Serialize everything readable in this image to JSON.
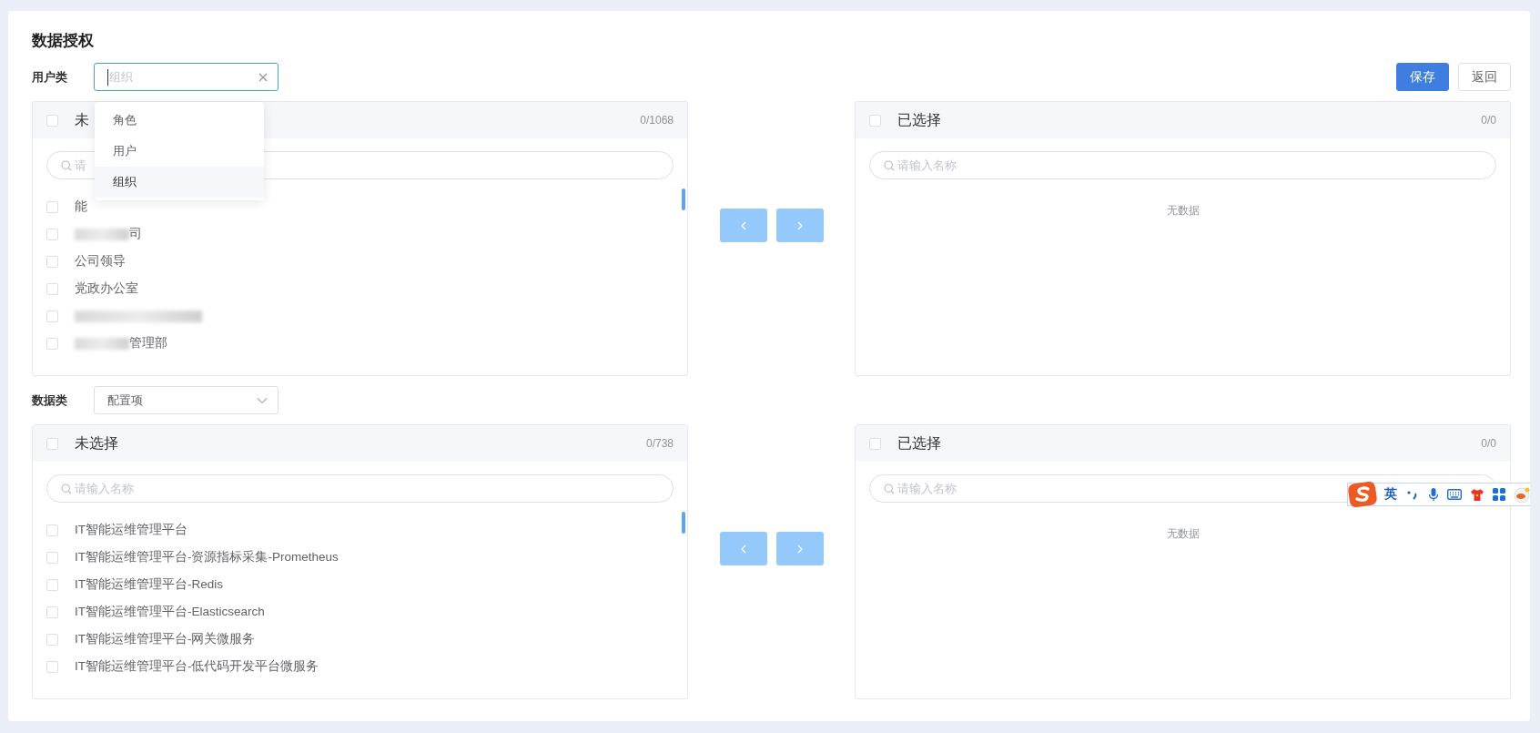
{
  "title": "数据授权",
  "actions": [
    {
      "label": "保存",
      "kind": "primary"
    },
    {
      "label": "返回",
      "kind": "default"
    }
  ],
  "sections": [
    {
      "label": "用户类",
      "select": {
        "placeholder": "组织",
        "focused": true,
        "clearable": true
      },
      "dropdown": {
        "options": [
          {
            "label": "角色",
            "selected": false
          },
          {
            "label": "用户",
            "selected": false
          },
          {
            "label": "组织",
            "selected": true
          }
        ]
      },
      "source": {
        "title": "未",
        "checked": false,
        "count": "0/1068",
        "search_placeholder": "请",
        "items": [
          {
            "label": "能",
            "checked": false,
            "blurred": false
          },
          {
            "label": "司",
            "checked": false,
            "blurred": true
          },
          {
            "label": "公司领导",
            "checked": false,
            "blurred": false
          },
          {
            "label": "党政办公室",
            "checked": false,
            "blurred": false
          },
          {
            "checked": false,
            "blurred": true
          },
          {
            "label": "管理部",
            "checked": false,
            "blurred": true
          }
        ]
      },
      "transfer_buttons": [
        {
          "disabled": true
        },
        {
          "disabled": true
        }
      ],
      "target": {
        "title": "已选择",
        "checked": false,
        "count": "0/0",
        "search_placeholder": "请输入名称",
        "empty_text": "无数据"
      }
    },
    {
      "label": "数据类",
      "select": {
        "value": "配置项",
        "focused": false,
        "clearable": false
      },
      "source": {
        "title": "未选择",
        "checked": false,
        "count": "0/738",
        "search_placeholder": "请输入名称",
        "items": [
          {
            "label": "IT智能运维管理平台",
            "checked": false,
            "blurred": false
          },
          {
            "label": "IT智能运维管理平台-资源指标采集-Prometheus",
            "checked": false,
            "blurred": false
          },
          {
            "label": "IT智能运维管理平台-Redis",
            "checked": false,
            "blurred": false
          },
          {
            "label": "IT智能运维管理平台-Elasticsearch",
            "checked": false,
            "blurred": false
          },
          {
            "label": "IT智能运维管理平台-网关微服务",
            "checked": false,
            "blurred": false
          },
          {
            "label": "IT智能运维管理平台-低代码开发平台微服务",
            "checked": false,
            "blurred": false
          }
        ]
      },
      "transfer_buttons": [
        {
          "disabled": true
        },
        {
          "disabled": true
        }
      ],
      "target": {
        "title": "已选择",
        "checked": false,
        "count": "0/0",
        "search_placeholder": "请输入名称",
        "empty_text": "无数据"
      }
    }
  ],
  "ime_toolbar": {
    "mode": "英"
  }
}
